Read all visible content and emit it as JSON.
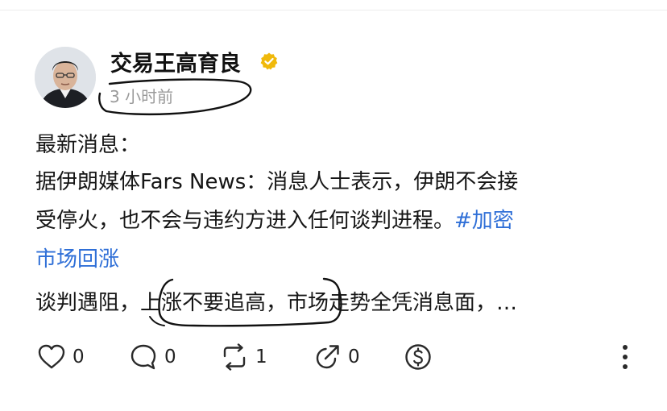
{
  "post": {
    "author": "交易王高育良",
    "time": "3 小时前",
    "lines": {
      "l1": "最新消息：",
      "l2": "据伊朗媒体Fars News：消息人士表示，伊朗不会接",
      "l3_text": "受停火，也不会与违约方进入任何谈判进程。",
      "l3_tag": "#加密",
      "l4_tag": "市场回涨",
      "l5": "谈判遇阻，上涨不要追高，市场走势全凭消息面，…"
    }
  },
  "actions": {
    "likes": "0",
    "comments": "0",
    "reposts": "1",
    "shares": "0"
  },
  "icons": {
    "verified": "verified-badge-icon",
    "like": "heart-icon",
    "comment": "comment-icon",
    "repost": "repost-icon",
    "share": "share-icon",
    "tip": "dollar-icon",
    "more": "more-vertical-icon"
  },
  "colors": {
    "hashtag": "#2f6fd7",
    "verified": "#f0b90b",
    "timestamp": "#9a9a9a",
    "text": "#161616"
  }
}
